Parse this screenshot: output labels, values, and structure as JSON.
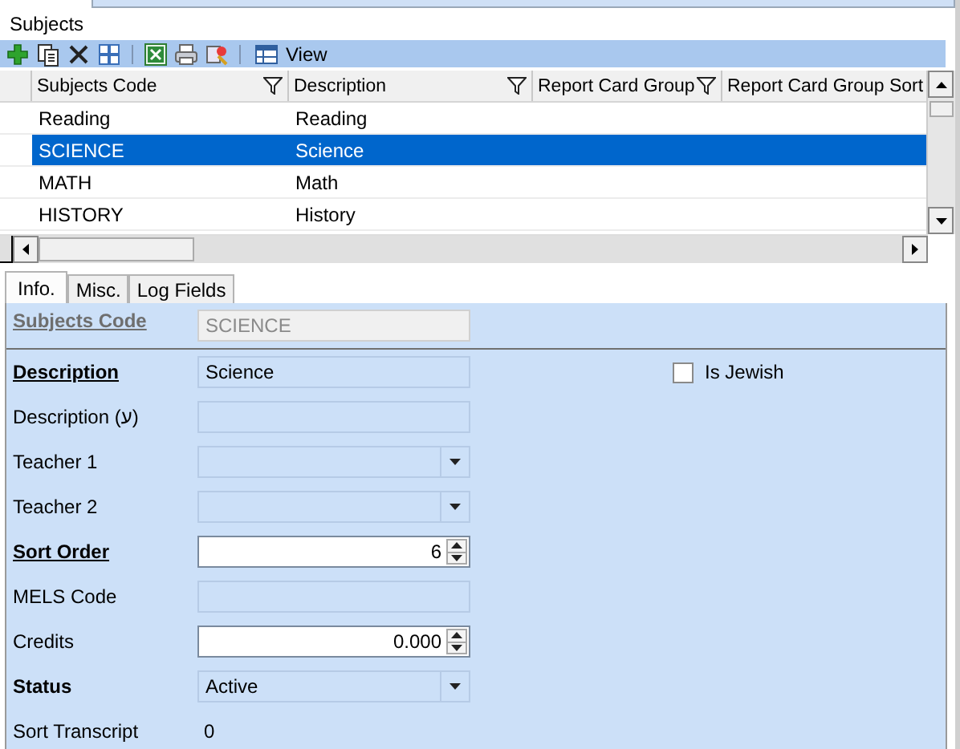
{
  "panel_title": "Subjects",
  "toolbar": {
    "view_button": {
      "label": "View"
    }
  },
  "grid": {
    "columns": [
      {
        "label": "Subjects Code",
        "filter": true
      },
      {
        "label": "Description",
        "filter": true
      },
      {
        "label": "Report Card Group",
        "filter": true
      },
      {
        "label": "Report Card Group Sort",
        "filter": false
      }
    ],
    "rows": [
      {
        "cells": [
          "Reading",
          "Reading",
          "",
          ""
        ],
        "selected": false
      },
      {
        "cells": [
          "SCIENCE",
          "Science",
          "",
          ""
        ],
        "selected": true
      },
      {
        "cells": [
          "MATH",
          "Math",
          "",
          ""
        ],
        "selected": false
      },
      {
        "cells": [
          "HISTORY",
          "History",
          "",
          ""
        ],
        "selected": false
      }
    ]
  },
  "tabs": [
    {
      "label": "Info.",
      "selected": true
    },
    {
      "label": "Misc.",
      "selected": false
    },
    {
      "label": "Log Fields",
      "selected": false
    }
  ],
  "form": {
    "fields": [
      {
        "label": "Subjects Code",
        "bold": true,
        "underlined": true,
        "kind": "text",
        "value": "SCIENCE",
        "disabled": true
      },
      {
        "label": "Description",
        "bold": true,
        "underlined": true,
        "kind": "text",
        "value": "Science",
        "disabled": false
      },
      {
        "label": "Description (ע)",
        "bold": false,
        "underlined": false,
        "kind": "text",
        "disabled": false
      },
      {
        "label": "Teacher 1",
        "bold": false,
        "underlined": false,
        "kind": "combo",
        "disabled": false
      },
      {
        "label": "Teacher 2",
        "bold": false,
        "underlined": false,
        "kind": "combo",
        "disabled": false
      },
      {
        "label": "Sort Order",
        "bold": true,
        "underlined": true,
        "kind": "spin",
        "value": "6",
        "disabled": false
      },
      {
        "label": "MELS Code",
        "bold": false,
        "underlined": false,
        "kind": "text",
        "disabled": false
      },
      {
        "label": "Credits",
        "bold": false,
        "underlined": false,
        "kind": "spin",
        "value": "0.000",
        "disabled": false
      },
      {
        "label": "Status",
        "bold": true,
        "underlined": false,
        "kind": "combo",
        "value": "Active",
        "disabled": false
      },
      {
        "label": "Sort Transcript",
        "bold": false,
        "underlined": false,
        "kind": "readout",
        "value": "0"
      }
    ],
    "checkbox": {
      "label": "Is Jewish",
      "checked": false
    }
  }
}
